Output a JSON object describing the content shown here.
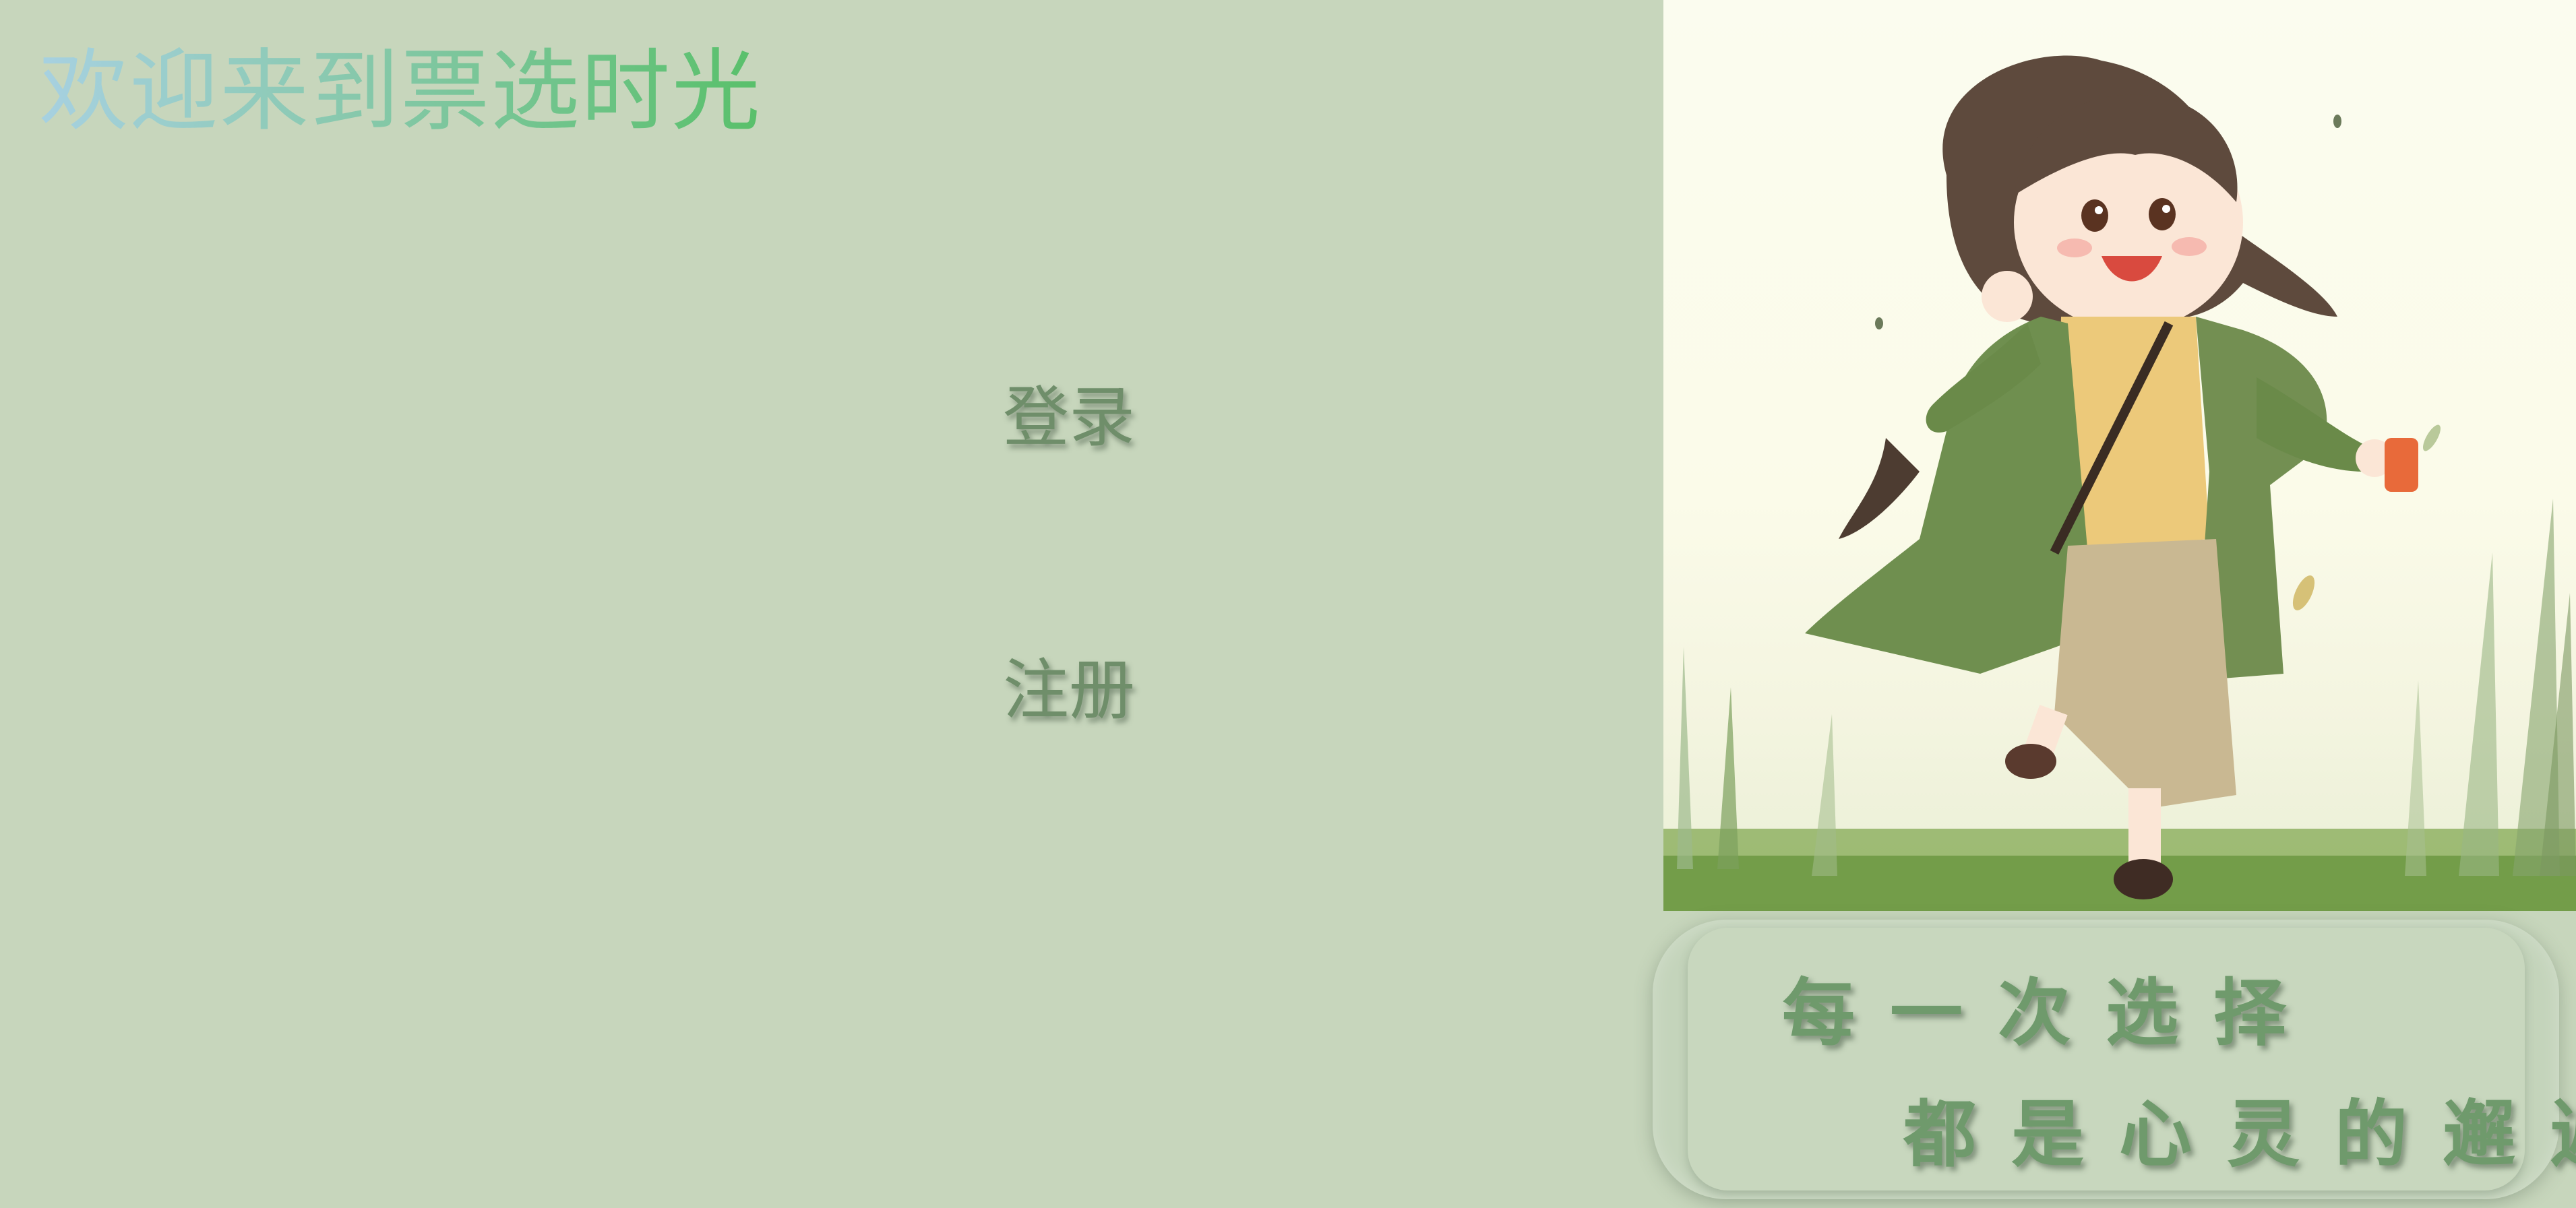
{
  "header": {
    "welcome_title": "欢迎来到票选时光"
  },
  "nav": {
    "login_label": "登录",
    "register_label": "注册"
  },
  "slogan": {
    "line1": "每一次选择",
    "line2": "都是心灵的邂逅"
  },
  "illustration": {
    "icon": "girl-running-illustration"
  },
  "colors": {
    "background": "#c7d6bc",
    "title_gradient_start": "#a7d1e1",
    "title_gradient_end": "#59c06a",
    "link_text": "#6f8e6a",
    "slogan_text": "#6f9a6c"
  }
}
